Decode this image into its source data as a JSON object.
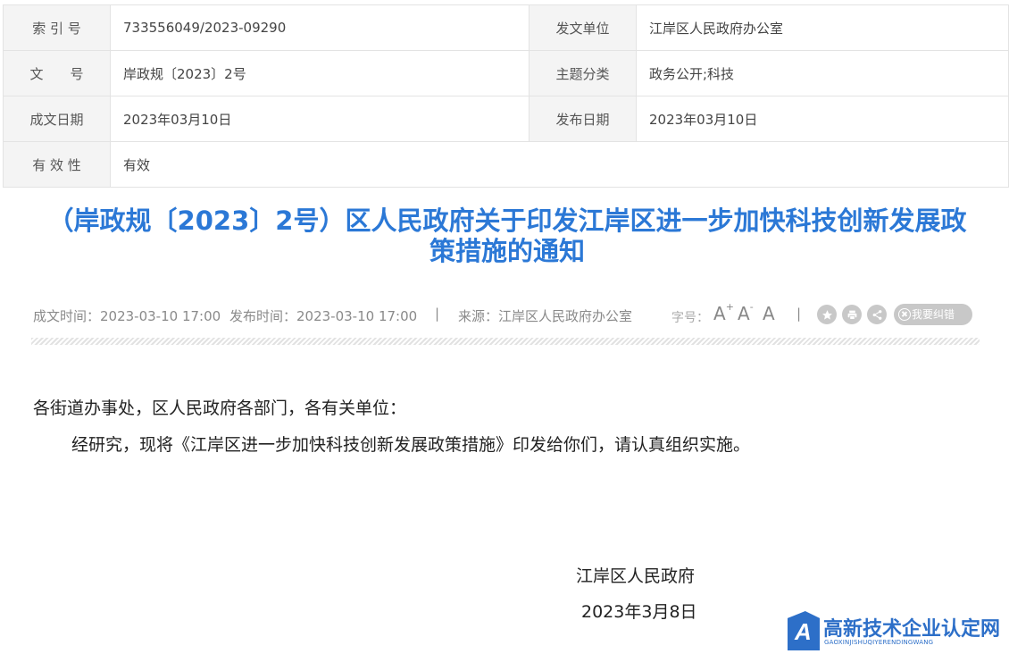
{
  "meta_table": {
    "rows": [
      {
        "k1": "索 引 号",
        "v1": "733556049/2023-09290",
        "k2": "发文单位",
        "v2": "江岸区人民政府办公室"
      },
      {
        "k1": "文　　号",
        "v1": "岸政规〔2023〕2号",
        "k2": "主题分类",
        "v2": "政务公开;科技"
      },
      {
        "k1": "成文日期",
        "v1": "2023年03月10日",
        "k2": "发布日期",
        "v2": "2023年03月10日"
      },
      {
        "k1": "有 效 性",
        "v1": "有效"
      }
    ]
  },
  "title": {
    "line1": "（岸政规〔2023〕2号）区人民政府关于印发江岸区进一步加快科技创新发展政",
    "line2": "策措施的通知"
  },
  "info": {
    "written_time": "成文时间：2023-03-10 17:00",
    "publish_time": "发布时间：2023-03-10 17:00",
    "separator": "|",
    "source": "来源：江岸区人民政府办公室",
    "font_size_label": "字号：",
    "font_large": "A",
    "font_large_mark": "+",
    "font_small": "A",
    "font_small_mark": "-",
    "font_default": "A",
    "icons": [
      "star-icon",
      "print-icon",
      "share-icon"
    ],
    "correction_label": "我要纠错"
  },
  "body": {
    "salutation": "各街道办事处，区人民政府各部门，各有关单位：",
    "paragraph": "经研究，现将《江岸区进一步加快科技创新发展政策措施》印发给你们，请认真组织实施。",
    "signature_org": "江岸区人民政府",
    "signature_date": "2023年3月8日"
  },
  "watermark": {
    "badge_letter": "A",
    "name": "高新技术企业认定网",
    "pinyin": "GAOXINJISHUQIYERENDINGWANG",
    "color": "#2d6fc8"
  },
  "colors": {
    "title": "#2b78d6",
    "label_bg": "#f4f4f4",
    "border": "#e3e3e3"
  }
}
